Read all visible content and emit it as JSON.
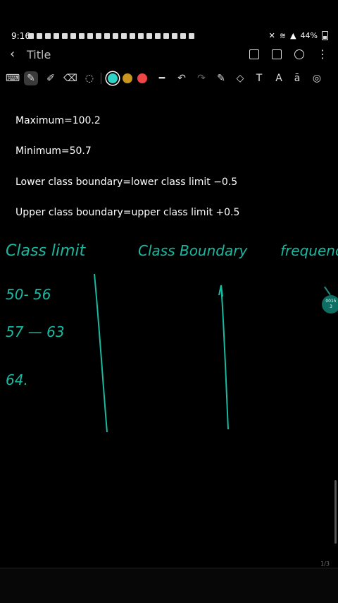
{
  "status": {
    "time": "9:16",
    "battery": "44%"
  },
  "titlebar": {
    "back": "‹",
    "title": "Title"
  },
  "toolbar": {
    "colors": [
      "#2ed3c6",
      "#c8961f",
      "#f04545"
    ]
  },
  "content": {
    "lines": [
      "Maximum=100.2",
      "Minimum=50.7",
      "Lower class boundary=lower class limit −0.5",
      "Upper class boundary=upper class limit +0.5"
    ],
    "handwriting": {
      "col1": "Class limit",
      "col2": "Class Boundary",
      "col3": "frequency",
      "rows": [
        "50- 56",
        "57 — 63",
        "64."
      ]
    }
  },
  "side": {
    "badge": "0015\n3"
  },
  "page": {
    "indicator": "1/3"
  }
}
